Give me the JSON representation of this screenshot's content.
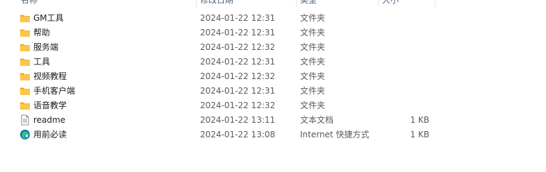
{
  "header": {
    "name": "名称",
    "date": "修改日期",
    "type": "类型",
    "size": "大小"
  },
  "files": [
    {
      "name": "GM工具",
      "date": "2024-01-22 12:31",
      "type": "文件夹",
      "size": "",
      "icon": "folder-icon"
    },
    {
      "name": "帮助",
      "date": "2024-01-22 12:31",
      "type": "文件夹",
      "size": "",
      "icon": "folder-icon"
    },
    {
      "name": "服务端",
      "date": "2024-01-22 12:32",
      "type": "文件夹",
      "size": "",
      "icon": "folder-icon"
    },
    {
      "name": "工具",
      "date": "2024-01-22 12:31",
      "type": "文件夹",
      "size": "",
      "icon": "folder-icon"
    },
    {
      "name": "视频教程",
      "date": "2024-01-22 12:32",
      "type": "文件夹",
      "size": "",
      "icon": "folder-icon"
    },
    {
      "name": "手机客户端",
      "date": "2024-01-22 12:31",
      "type": "文件夹",
      "size": "",
      "icon": "folder-icon"
    },
    {
      "name": "语音教学",
      "date": "2024-01-22 12:32",
      "type": "文件夹",
      "size": "",
      "icon": "folder-icon"
    },
    {
      "name": "readme",
      "date": "2024-01-22 13:11",
      "type": "文本文档",
      "size": "1 KB",
      "icon": "text-document-icon"
    },
    {
      "name": "用前必读",
      "date": "2024-01-22 13:08",
      "type": "Internet 快捷方式",
      "size": "1 KB",
      "icon": "edge-shortcut-icon"
    }
  ],
  "colors": {
    "folder": "#f8c84a",
    "folder_dark": "#e6a92c",
    "edge_blue": "#0c6fd1",
    "edge_green": "#3cc46b"
  }
}
